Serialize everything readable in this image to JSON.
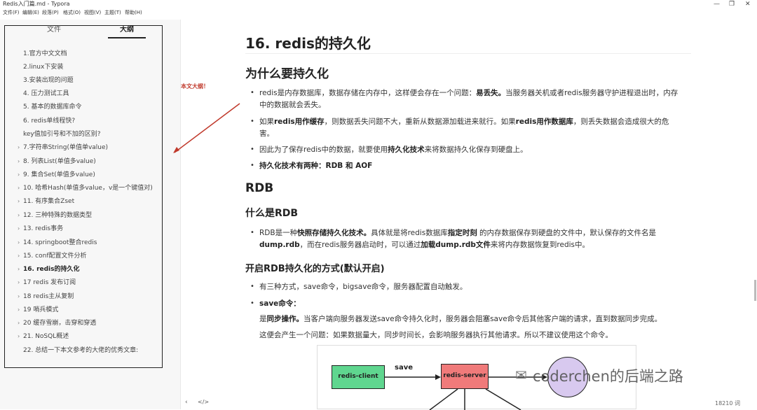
{
  "window": {
    "title": "Redis入门篇.md - Typora",
    "controls": [
      "—",
      "❐",
      "✕"
    ]
  },
  "menu": [
    "文件(F)",
    "编辑(E)",
    "段落(P)",
    "格式(O)",
    "视图(V)",
    "主题(T)",
    "帮助(H)"
  ],
  "sidebar": {
    "tabs": [
      "文件",
      "大纲"
    ],
    "active_tab": "大纲",
    "items": [
      {
        "label": "1.官方中文文档",
        "arrow": ""
      },
      {
        "label": "2.linux下安装",
        "arrow": ""
      },
      {
        "label": "3.安装出现的问题",
        "arrow": ""
      },
      {
        "label": "4. 压力测试工具",
        "arrow": ""
      },
      {
        "label": "5. 基本的数据库命令",
        "arrow": ""
      },
      {
        "label": "6. redis单线程快?",
        "arrow": ""
      },
      {
        "label": "key值加引号和不加的区别?",
        "arrow": ""
      },
      {
        "label": "7.字符串String(单值单value)",
        "arrow": "›"
      },
      {
        "label": "8. 列表List(单值多value)",
        "arrow": "›"
      },
      {
        "label": "9. 集合Set(单值多value)",
        "arrow": "›"
      },
      {
        "label": "10. 哈希Hash(单值多value，v是一个键值对)",
        "arrow": "›"
      },
      {
        "label": "11. 有序集合Zset",
        "arrow": "›"
      },
      {
        "label": "12. 三种特殊的数据类型",
        "arrow": "›"
      },
      {
        "label": "13. redis事务",
        "arrow": "›"
      },
      {
        "label": "14. springboot整合redis",
        "arrow": "›"
      },
      {
        "label": "15. conf配置文件分析",
        "arrow": "›"
      },
      {
        "label": "16. redis的持久化",
        "arrow": "›"
      },
      {
        "label": "17 redis 发布订阅",
        "arrow": "›"
      },
      {
        "label": "18 redis主从复制",
        "arrow": "›"
      },
      {
        "label": "19 哨兵模式",
        "arrow": "›"
      },
      {
        "label": "20 缓存雪崩，击穿和穿透",
        "arrow": "›"
      },
      {
        "label": "21. NoSQL概述",
        "arrow": "›"
      },
      {
        "label": "22. 总结一下本文参考的大佬的优秀文章:",
        "arrow": ""
      }
    ],
    "active_index": 16
  },
  "annotation": "本文大纲！",
  "doc": {
    "h1": "16. redis的持久化",
    "h2_why": "为什么要持久化",
    "p1a": "redis是内存数据库，数据存储在内存中，这样便会存在一个问题：",
    "p1b": "易丢失。",
    "p1c": "当服务器关机或者redis服务器守护进程退出时，内存",
    "p1d": "中的数据就会丢失。",
    "p2a": "如果",
    "p2b": "redis用作缓存",
    "p2c": "，则数据丢失问题不大，重新从数据源加载进来就行。如果",
    "p2d": "redis用作数据库",
    "p2e": "，则丢失数据会造成很大的危",
    "p2f": "害。",
    "p3a": "因此为了保存redis中的数据，就要使用",
    "p3b": "持久化技术",
    "p3c": "来将数据持久化保存到硬盘上。",
    "p4": "持久化技术有两种：RDB 和 AOF",
    "h2_rdb": "RDB",
    "h3_what": "什么是RDB",
    "p5a": "RDB是一种",
    "p5b": "快照存储持久化技术。",
    "p5c": "具体就是将redis数据库",
    "p5d": "指定时刻",
    "p5e": " 的内存数据保存到硬盘的文件中，默认保存的文件名是",
    "p5f": "dump.rdb",
    "p5g": "，而在redis服务器启动时，可以通过",
    "p5h": "加载dump.rdb文件",
    "p5i": "来将内存数据恢复到redis中。",
    "h4_open": "开启RDB持久化的方式(默认开启)",
    "p6": "有三种方式，save命令，bigsave命令，服务器配置自动触发。",
    "p7": "save命令：",
    "p8a": "是",
    "p8b": "同步操作。",
    "p8c": "当客户端向服务器发送save命令持久化时，服务器会阻塞save命令后其他客户端的请求，直到数据同步完成。",
    "p9": "这便会产生一个问题：如果数据量大，同步时间长，会影响服务器执行其他请求。所以不建议使用这个命令。"
  },
  "figure": {
    "client": "redis-client",
    "server": "redis-server",
    "save": "save"
  },
  "watermark": "coderchen的后端之路",
  "bottom": {
    "prev": "‹",
    "code": "</>",
    "wordcount": "18210 词"
  },
  "colors": {
    "annotation": "#c0392b",
    "client_node": "#5fd68f",
    "server_node": "#f07a7a",
    "circle_node": "#d8c9ef"
  }
}
